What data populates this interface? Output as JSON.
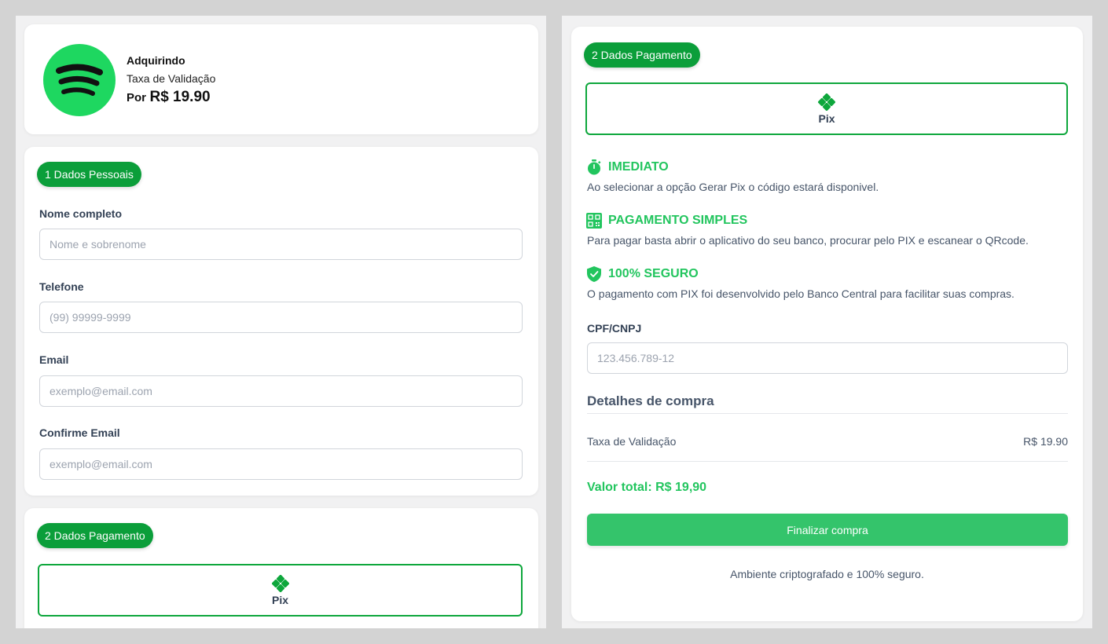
{
  "product": {
    "heading": "Adquirindo",
    "name": "Taxa de Validação",
    "price_prefix": "Por",
    "price": "R$ 19.90"
  },
  "personal": {
    "badge": "1 Dados Pessoais",
    "fields": [
      {
        "label": "Nome completo",
        "placeholder": "Nome e sobrenome"
      },
      {
        "label": "Telefone",
        "placeholder": "(99) 99999-9999"
      },
      {
        "label": "Email",
        "placeholder": "exemplo@email.com"
      },
      {
        "label": "Confirme Email",
        "placeholder": "exemplo@email.com"
      }
    ]
  },
  "payment": {
    "badge": "2 Dados Pagamento",
    "method_label": "Pix",
    "features": [
      {
        "icon": "stopwatch-icon",
        "title": "IMEDIATO",
        "desc": "Ao selecionar a opção Gerar Pix o código estará disponivel."
      },
      {
        "icon": "qrcode-icon",
        "title": "PAGAMENTO SIMPLES",
        "desc": "Para pagar basta abrir o aplicativo do seu banco, procurar pelo PIX e escanear o QRcode."
      },
      {
        "icon": "shield-check-icon",
        "title": "100% SEGURO",
        "desc": "O pagamento com PIX foi desenvolvido pelo Banco Central para facilitar suas compras."
      }
    ],
    "cpf_label": "CPF/CNPJ",
    "cpf_placeholder": "123.456.789-12"
  },
  "summary": {
    "title": "Detalhes de compra",
    "item_name": "Taxa de Validação",
    "item_price": "R$ 19.90",
    "total": "Valor total: R$ 19,90",
    "button": "Finalizar compra",
    "footer": "Ambiente criptografado e 100% seguro."
  },
  "colors": {
    "brand_green": "#0b9e3a",
    "accent_green": "#22c55e",
    "button_green": "#34c46b",
    "spotify_green": "#1ed760"
  }
}
